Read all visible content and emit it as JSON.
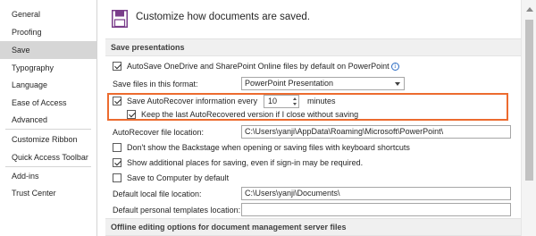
{
  "sidebar": {
    "items": [
      {
        "label": "General"
      },
      {
        "label": "Proofing"
      },
      {
        "label": "Save"
      },
      {
        "label": "Typography"
      },
      {
        "label": "Language"
      },
      {
        "label": "Ease of Access"
      },
      {
        "label": "Advanced"
      },
      {
        "label": "Customize Ribbon"
      },
      {
        "label": "Quick Access Toolbar"
      },
      {
        "label": "Add-ins"
      },
      {
        "label": "Trust Center"
      }
    ],
    "selected": "Save"
  },
  "main": {
    "header": {
      "icon": "save-disk-icon",
      "title": "Customize how documents are saved."
    },
    "save_presentations": {
      "title": "Save presentations",
      "autosave": {
        "label": "AutoSave OneDrive and SharePoint Online files by default on PowerPoint",
        "checked": true,
        "info_icon": "info-icon"
      },
      "format": {
        "label": "Save files in this format:",
        "value": "PowerPoint Presentation"
      },
      "autorecover": {
        "label": "Save AutoRecover information every",
        "checked": true,
        "value": "10",
        "unit": "minutes"
      },
      "keep_last": {
        "label": "Keep the last AutoRecovered version if I close without saving",
        "checked": true
      },
      "autorecover_location": {
        "label": "AutoRecover file location:",
        "value": "C:\\Users\\yanji\\AppData\\Roaming\\Microsoft\\PowerPoint\\"
      },
      "backstage": {
        "label": "Don't show the Backstage when opening or saving files with keyboard shortcuts",
        "checked": false
      },
      "additional_places": {
        "label": "Show additional places for saving, even if sign-in may be required.",
        "checked": true
      },
      "save_to_computer": {
        "label": "Save to Computer by default",
        "checked": false
      },
      "default_local": {
        "label": "Default local file location:",
        "value": "C:\\Users\\yanji\\Documents\\"
      },
      "default_templates": {
        "label": "Default personal templates location:",
        "value": ""
      }
    },
    "offline": {
      "title": "Offline editing options for document management server files"
    }
  },
  "colors": {
    "highlight": "#ec6b2f",
    "selected_nav": "#d6d6d6",
    "section_bg": "#f0f0f0"
  }
}
